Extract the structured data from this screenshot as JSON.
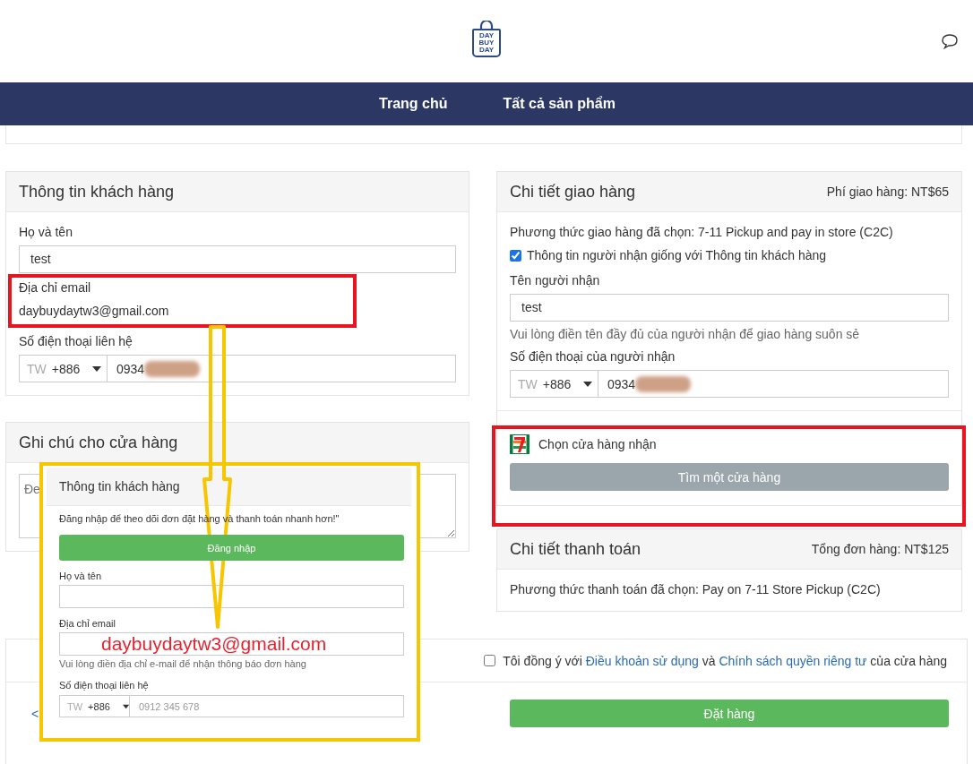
{
  "header": {
    "logo_lines": [
      "DAY",
      "BUY",
      "DAY"
    ]
  },
  "nav": [
    "Trang chủ",
    "Tất cả sản phẩm"
  ],
  "customer_card": {
    "title": "Thông tin khách hàng",
    "fields": [
      {
        "kind": "input",
        "label": "Họ và tên",
        "value": "test"
      },
      {
        "kind": "static",
        "label": "Địa chỉ email",
        "value": "daybuydaytw3@gmail.com"
      },
      {
        "kind": "phone",
        "label": "Số điện thoại liên hệ",
        "country": "TW",
        "code": "+886",
        "value": "0934"
      }
    ]
  },
  "note_card": {
    "title": "Ghi chú cho cửa hàng",
    "placeholder": "Đe"
  },
  "shipping_card": {
    "title": "Chi tiết giao hàng",
    "fee": "Phí giao hàng: NT$65",
    "method": "Phương thức giao hàng đã chọn: 7-11 Pickup and pay in store (C2C)",
    "same_as_customer": {
      "label": "Thông tin người nhận giống với Thông tin khách hàng",
      "checked": true
    },
    "fields": [
      {
        "kind": "input",
        "label": "Tên người nhận",
        "value": "test",
        "hint": "Vui lòng điền tên đầy đủ của người nhận để giao hàng suôn sẻ"
      },
      {
        "kind": "phone",
        "label": "Số điện thoại của người nhận",
        "country": "TW",
        "code": "+886",
        "value": "0934"
      }
    ],
    "store": {
      "label": "Chọn cửa hàng nhận",
      "button": "Tìm một cửa hàng"
    }
  },
  "payment_card": {
    "title": "Chi tiết thanh toán",
    "total": "Tổng đơn hàng: NT$125",
    "method": "Phương thức thanh toán đã chọn: Pay on 7-11 Store Pickup (C2C)"
  },
  "terms": {
    "checked": false,
    "parts": [
      {
        "kind": "text",
        "text": "Tôi đồng ý với "
      },
      {
        "kind": "link",
        "text": "Điều khoản sử dụng"
      },
      {
        "kind": "text",
        "text": " và "
      },
      {
        "kind": "link",
        "text": "Chính sách quyền riêng tư"
      },
      {
        "kind": "text",
        "text": " của cửa hàng"
      }
    ]
  },
  "back_link": "<",
  "order_button": "Đặt hàng",
  "inset": {
    "title": "Thông tin khách hàng",
    "notice": "Đăng nhập để theo dõi đơn đặt hàng và thanh toán nhanh hơn!\"",
    "login_button": "Đăng nhập",
    "fields": [
      {
        "kind": "input",
        "label": "Họ và tên"
      },
      {
        "kind": "input",
        "label": "Địa chỉ email",
        "overlay": "daybuydaytw3@gmail.com",
        "hint": "Vui lòng điền địa chỉ e-mail để nhận thông báo đơn hàng"
      },
      {
        "kind": "phone",
        "label": "Số điện thoại liên hệ",
        "country": "TW",
        "code": "+886",
        "placeholder": "0912 345 678"
      }
    ]
  }
}
